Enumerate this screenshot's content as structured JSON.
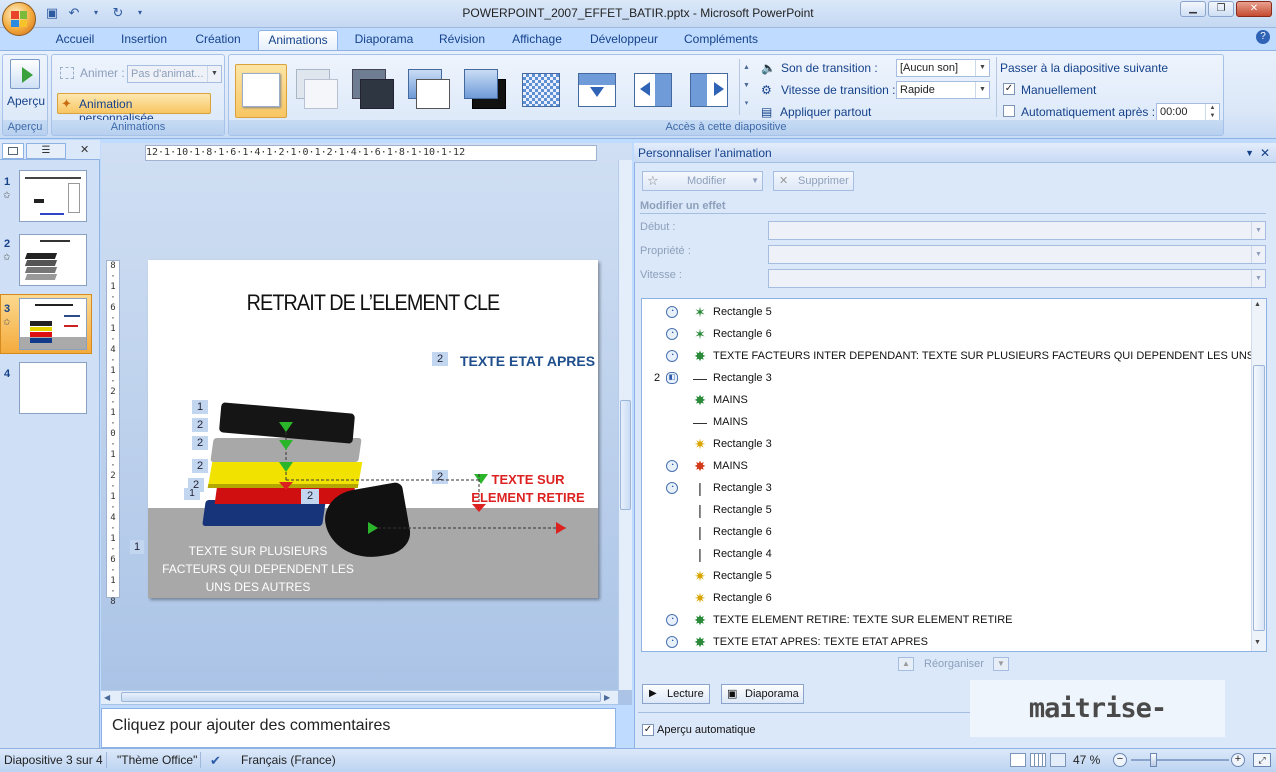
{
  "window": {
    "title": "POWERPOINT_2007_EFFET_BATIR.pptx - Microsoft PowerPoint"
  },
  "tabs": [
    "Accueil",
    "Insertion",
    "Création",
    "Animations",
    "Diaporama",
    "Révision",
    "Affichage",
    "Développeur",
    "Compléments"
  ],
  "active_tab": "Animations",
  "ribbon": {
    "apercu": {
      "button": "Aperçu",
      "group": "Aperçu"
    },
    "animations": {
      "animer_label": "Animer :",
      "animer_value": "Pas d'animat...",
      "custom_button": "Animation personnalisée",
      "group": "Animations"
    },
    "transition": {
      "son_label": "Son de transition :",
      "son_value": "[Aucun son]",
      "vitesse_label": "Vitesse de transition :",
      "vitesse_value": "Rapide",
      "appliquer": "Appliquer partout",
      "group": "Accès à cette diapositive"
    },
    "advance": {
      "heading": "Passer à la diapositive suivante",
      "manuel": "Manuellement",
      "manuel_checked": true,
      "auto": "Automatiquement après :",
      "auto_checked": false,
      "auto_value": "00:00"
    }
  },
  "thumbnails": [
    {
      "num": "1",
      "has_anim": true
    },
    {
      "num": "2",
      "has_anim": true
    },
    {
      "num": "3",
      "has_anim": true,
      "selected": true
    },
    {
      "num": "4",
      "has_anim": false
    }
  ],
  "ruler": {
    "horizontal": "12·1·10·1·8·1·6·1·4·1·2·1·0·1·2·1·4·1·6·1·8·1·10·1·12",
    "vertical": "8·1·6·1·4·1·2·1·0·1·2·1·4·1·6·1·8"
  },
  "slide": {
    "title": "RETRAIT DE L’ELEMENT CLE",
    "etat_apres": "TEXTE ETAT APRES",
    "etat_apres_tag": "2",
    "element_retire": "TEXTE SUR ELEMENT RETIRE",
    "element_retire_tag": "2",
    "bottom_text": "TEXTE SUR PLUSIEURS FACTEURS QUI DEPENDENT LES UNS DES AUTRES",
    "bottom_tag": "1",
    "stack_tags": [
      "1",
      "2",
      "2",
      "2",
      "2",
      "1"
    ],
    "hand_tag": "2"
  },
  "notes_placeholder": "Cliquez pour ajouter des commentaires",
  "taskpane": {
    "title": "Personnaliser l'animation",
    "modifier": "Modifier",
    "supprimer": "Supprimer",
    "section": "Modifier un effet",
    "debut": "Début :",
    "propriete": "Propriété :",
    "vitesse": "Vitesse :",
    "items": [
      {
        "num": "",
        "trigger": "clock",
        "effect": "emphasis-green",
        "label": "Rectangle 5"
      },
      {
        "num": "",
        "trigger": "clock",
        "effect": "emphasis-green",
        "label": "Rectangle 6"
      },
      {
        "num": "",
        "trigger": "clock",
        "effect": "entrance-green",
        "label": "TEXTE FACTEURS INTER DEPENDANT: TEXTE SUR PLUSIEURS FACTEURS QUI DEPENDENT LES UNS DES AU..."
      },
      {
        "num": "2",
        "trigger": "mouse",
        "effect": "path-line",
        "label": "Rectangle 3"
      },
      {
        "num": "",
        "trigger": "",
        "effect": "entrance-green",
        "label": "MAINS"
      },
      {
        "num": "",
        "trigger": "",
        "effect": "path-line",
        "label": "MAINS"
      },
      {
        "num": "",
        "trigger": "",
        "effect": "emphasis-yellow",
        "label": "Rectangle 3"
      },
      {
        "num": "",
        "trigger": "clock",
        "effect": "exit-red",
        "label": "MAINS"
      },
      {
        "num": "",
        "trigger": "clock",
        "effect": "path-vertical",
        "label": "Rectangle 3"
      },
      {
        "num": "",
        "trigger": "",
        "effect": "path-vertical",
        "label": "Rectangle 5"
      },
      {
        "num": "",
        "trigger": "",
        "effect": "path-vertical",
        "label": "Rectangle 6"
      },
      {
        "num": "",
        "trigger": "",
        "effect": "path-vertical",
        "label": "Rectangle 4"
      },
      {
        "num": "",
        "trigger": "",
        "effect": "emphasis-yellow",
        "label": "Rectangle 5"
      },
      {
        "num": "",
        "trigger": "",
        "effect": "emphasis-yellow",
        "label": "Rectangle 6"
      },
      {
        "num": "",
        "trigger": "clock",
        "effect": "entrance-green",
        "label": "TEXTE ELEMENT RETIRE: TEXTE SUR ELEMENT RETIRE"
      },
      {
        "num": "",
        "trigger": "clock",
        "effect": "entrance-green",
        "label": "TEXTE ETAT APRES: TEXTE ETAT APRES"
      }
    ],
    "reorganiser": "Réorganiser",
    "lecture": "Lecture",
    "diaporama": "Diaporama",
    "apercu_auto": "Aperçu automatique",
    "apercu_auto_checked": true
  },
  "statusbar": {
    "slide": "Diapositive 3 sur 4",
    "theme": "\"Thème Office\"",
    "language": "Français (France)",
    "zoom": "47 %"
  },
  "watermark": "maitrise-excel.com"
}
